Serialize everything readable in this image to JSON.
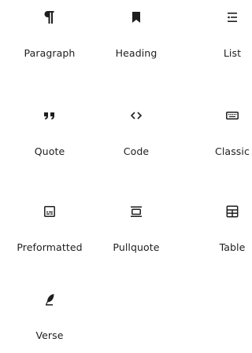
{
  "blocks": [
    {
      "label": "Paragraph",
      "icon": "paragraph-icon"
    },
    {
      "label": "Heading",
      "icon": "heading-icon"
    },
    {
      "label": "List",
      "icon": "list-icon"
    },
    {
      "label": "Quote",
      "icon": "quote-icon"
    },
    {
      "label": "Code",
      "icon": "code-icon"
    },
    {
      "label": "Classic",
      "icon": "keyboard-icon"
    },
    {
      "label": "Preformatted",
      "icon": "preformatted-icon"
    },
    {
      "label": "Pullquote",
      "icon": "pullquote-icon"
    },
    {
      "label": "Table",
      "icon": "table-icon"
    },
    {
      "label": "Verse",
      "icon": "feather-icon"
    }
  ]
}
